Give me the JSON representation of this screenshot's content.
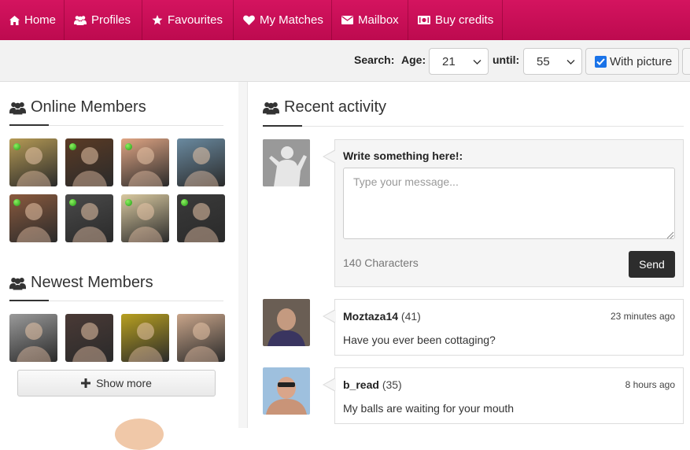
{
  "nav": {
    "items": [
      {
        "label": "Home",
        "icon": "home-icon"
      },
      {
        "label": "Profiles",
        "icon": "users-icon"
      },
      {
        "label": "Favourites",
        "icon": "star-icon"
      },
      {
        "label": "My Matches",
        "icon": "heart-icon"
      },
      {
        "label": "Mailbox",
        "icon": "envelope-icon"
      },
      {
        "label": "Buy credits",
        "icon": "money-icon"
      }
    ],
    "color": "#c90d55"
  },
  "search": {
    "label": "Search:",
    "age_label": "Age:",
    "age_from": "21",
    "until_label": "until:",
    "age_to": "55",
    "with_picture_label": "With picture",
    "with_picture_checked": true
  },
  "online": {
    "title": "Online Members",
    "members": [
      {
        "online": true,
        "tone": "#b59a55"
      },
      {
        "online": true,
        "tone": "#5b3b25"
      },
      {
        "online": true,
        "tone": "#e0a584"
      },
      {
        "online": false,
        "tone": "#6a8aa0"
      },
      {
        "online": true,
        "tone": "#8a5a3e"
      },
      {
        "online": true,
        "tone": "#4a4a4a"
      },
      {
        "online": true,
        "tone": "#d9c9a0"
      },
      {
        "online": true,
        "tone": "#3a3a3a"
      }
    ]
  },
  "newest": {
    "title": "Newest Members",
    "members": [
      {
        "tone": "#9a9a9a"
      },
      {
        "tone": "#4a3a36"
      },
      {
        "tone": "#b8a020"
      },
      {
        "tone": "#c9a58a"
      }
    ],
    "show_more_label": "Show more"
  },
  "activity": {
    "title": "Recent activity",
    "compose": {
      "label": "Write something here!:",
      "placeholder": "Type your message...",
      "char_count": "140 Characters",
      "send_label": "Send"
    },
    "items": [
      {
        "name": "Moztaza14",
        "age": "(41)",
        "time": "23 minutes ago",
        "message": "Have you ever been cottaging?",
        "tone": "#5a5048"
      },
      {
        "name": "b_read",
        "age": "(35)",
        "time": "8 hours ago",
        "message": "My balls are waiting for your mouth",
        "tone": "#8aa8c8"
      }
    ]
  }
}
